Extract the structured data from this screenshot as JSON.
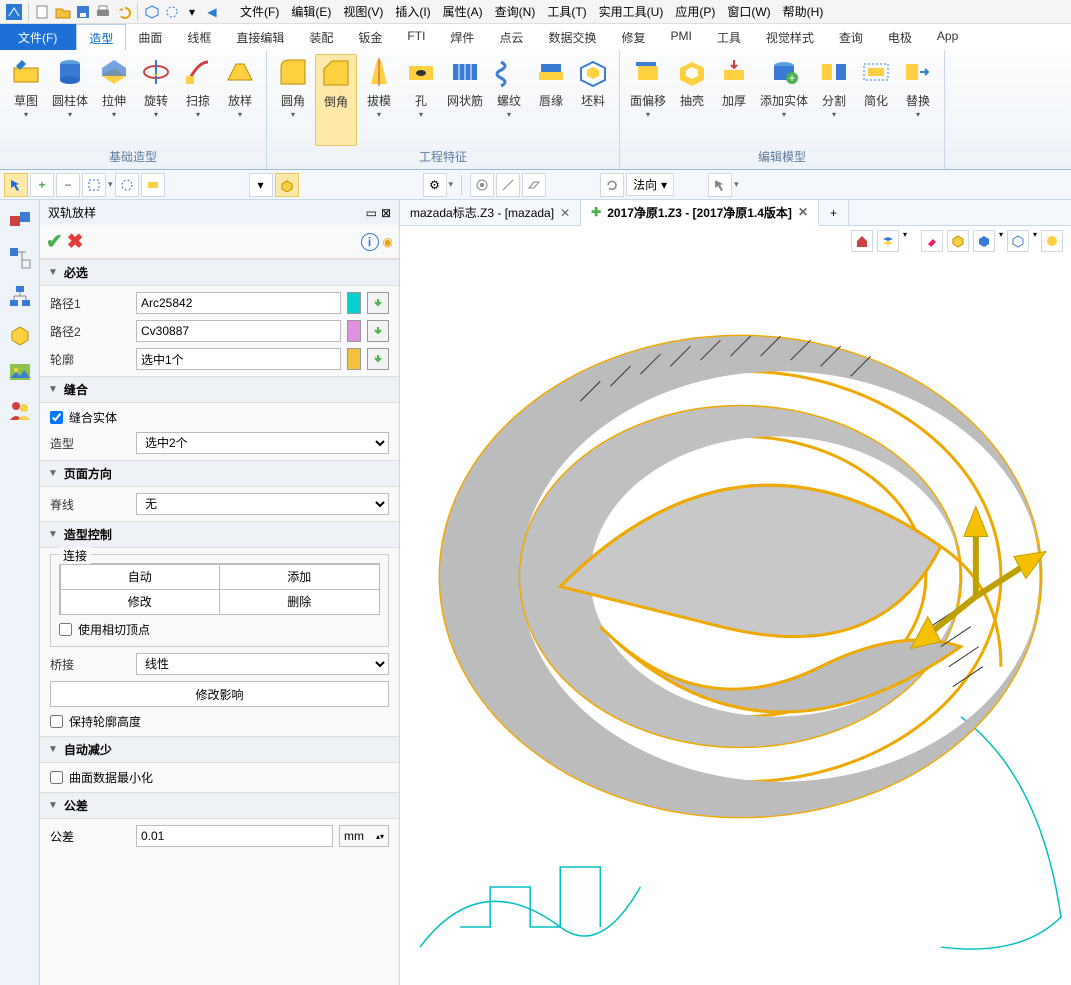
{
  "menubar": {
    "items": [
      {
        "label": "文件(F)"
      },
      {
        "label": "编辑(E)"
      },
      {
        "label": "视图(V)"
      },
      {
        "label": "插入(I)"
      },
      {
        "label": "属性(A)"
      },
      {
        "label": "查询(N)"
      },
      {
        "label": "工具(T)"
      },
      {
        "label": "实用工具(U)"
      },
      {
        "label": "应用(P)"
      },
      {
        "label": "窗口(W)"
      },
      {
        "label": "帮助(H)"
      }
    ]
  },
  "ribbon_tabs": {
    "file": "文件(F)",
    "items": [
      {
        "label": "造型",
        "active": true
      },
      {
        "label": "曲面"
      },
      {
        "label": "线框"
      },
      {
        "label": "直接编辑"
      },
      {
        "label": "装配"
      },
      {
        "label": "钣金"
      },
      {
        "label": "FTI"
      },
      {
        "label": "焊件"
      },
      {
        "label": "点云"
      },
      {
        "label": "数据交换"
      },
      {
        "label": "修复"
      },
      {
        "label": "PMI"
      },
      {
        "label": "工具"
      },
      {
        "label": "视觉样式"
      },
      {
        "label": "查询"
      },
      {
        "label": "电极"
      },
      {
        "label": "App"
      }
    ]
  },
  "ribbon": {
    "groups": [
      {
        "label": "基础造型",
        "items": [
          {
            "label": "草图"
          },
          {
            "label": "圆柱体"
          },
          {
            "label": "拉伸"
          },
          {
            "label": "旋转"
          },
          {
            "label": "扫掠"
          },
          {
            "label": "放样"
          }
        ]
      },
      {
        "label": "工程特征",
        "items": [
          {
            "label": "圆角"
          },
          {
            "label": "倒角",
            "highlight": true
          },
          {
            "label": "拔模"
          },
          {
            "label": "孔"
          },
          {
            "label": "网状筋"
          },
          {
            "label": "螺纹"
          },
          {
            "label": "唇缘"
          },
          {
            "label": "坯料"
          }
        ]
      },
      {
        "label": "编辑模型",
        "items": [
          {
            "label": "面偏移"
          },
          {
            "label": "抽壳"
          },
          {
            "label": "加厚"
          },
          {
            "label": "添加实体"
          },
          {
            "label": "分割"
          },
          {
            "label": "简化"
          },
          {
            "label": "替换"
          }
        ]
      }
    ]
  },
  "sel_toolbar": {
    "direction_label": "法向"
  },
  "task": {
    "title": "双轨放样",
    "sections": {
      "required": {
        "head": "必选"
      },
      "path1": {
        "label": "路径1",
        "value": "Arc25842"
      },
      "path2": {
        "label": "路径2",
        "value": "Cv30887"
      },
      "profile": {
        "label": "轮廓",
        "value": "选中1个"
      },
      "sew": {
        "head": "缝合",
        "chk": "缝合实体",
        "shape_label": "造型",
        "shape_value": "选中2个"
      },
      "page_dir": {
        "head": "页面方向",
        "spine_label": "脊线",
        "spine_value": "无"
      },
      "shape_ctrl": {
        "head": "造型控制",
        "connect_label": "连接",
        "btns": {
          "auto": "自动",
          "add": "添加",
          "mod": "修改",
          "del": "删除"
        },
        "chk_tangent": "使用相切顶点",
        "bridge_label": "桥接",
        "bridge_value": "线性",
        "affect_btn": "修改影响",
        "chk_keep": "保持轮廓高度"
      },
      "auto_reduce": {
        "head": "自动减少",
        "chk": "曲面数据最小化"
      },
      "tol": {
        "head": "公差",
        "label": "公差",
        "value": "0.01",
        "unit": "mm"
      }
    }
  },
  "tabs": {
    "t1": {
      "label": "mazada标志.Z3 - [mazada]"
    },
    "t2": {
      "label": "2017净原1.Z3 - [2017净原1.4版本]"
    },
    "add": "+"
  }
}
